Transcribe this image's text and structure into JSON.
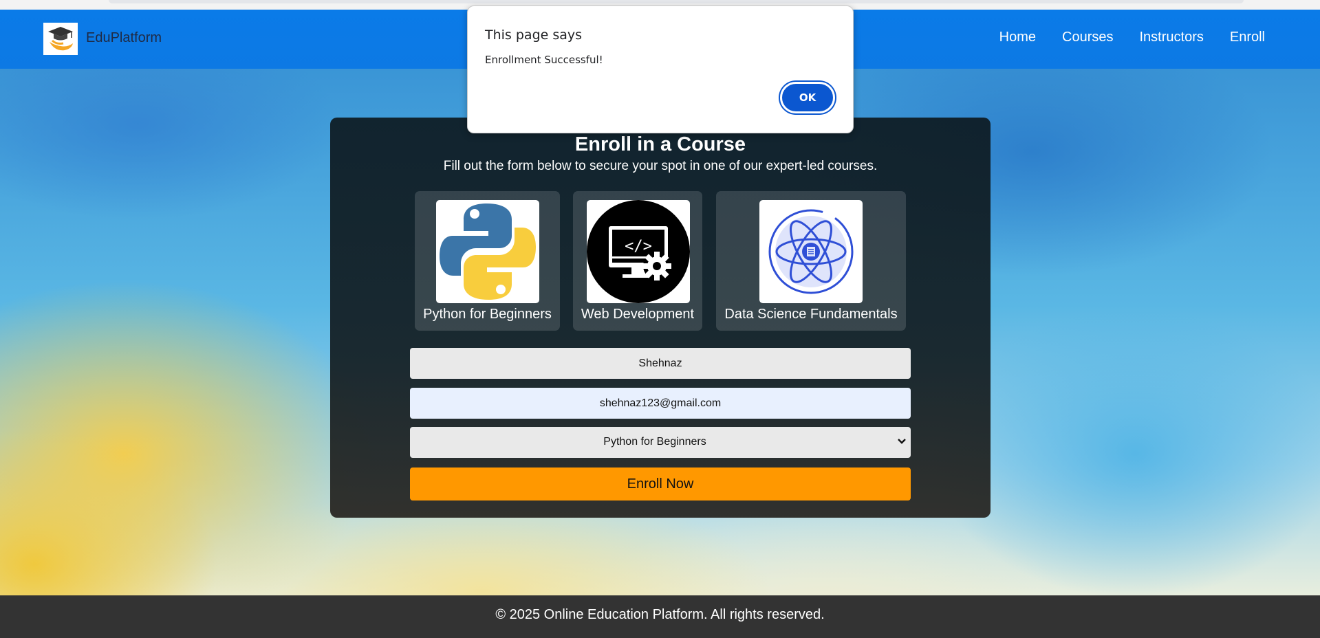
{
  "brand": {
    "name": "EduPlatform",
    "logo_icon": "graduation-cap-hand-icon"
  },
  "nav": {
    "items": [
      "Home",
      "Courses",
      "Instructors",
      "Enroll"
    ]
  },
  "enroll": {
    "title": "Enroll in a Course",
    "subtitle": "Fill out the form below to secure your spot in one of our expert-led courses.",
    "courses": [
      {
        "label": "Python for Beginners",
        "icon": "python-logo-icon"
      },
      {
        "label": "Web Development",
        "icon": "monitor-code-gear-icon"
      },
      {
        "label": "Data Science Fundamentals",
        "icon": "atom-icon"
      }
    ],
    "form": {
      "name_value": "Shehnaz",
      "email_value": "shehnaz123@gmail.com",
      "course_selected": "Python for Beginners",
      "submit_label": "Enroll Now"
    }
  },
  "footer": {
    "text": "© 2025 Online Education Platform. All rights reserved."
  },
  "dialog": {
    "title": "This page says",
    "message": "Enrollment Successful!",
    "ok_label": "OK"
  },
  "colors": {
    "header": "#0d79e4",
    "enroll_button": "#ff9800",
    "footer": "#333333",
    "dialog_ok": "#0b57d0"
  }
}
